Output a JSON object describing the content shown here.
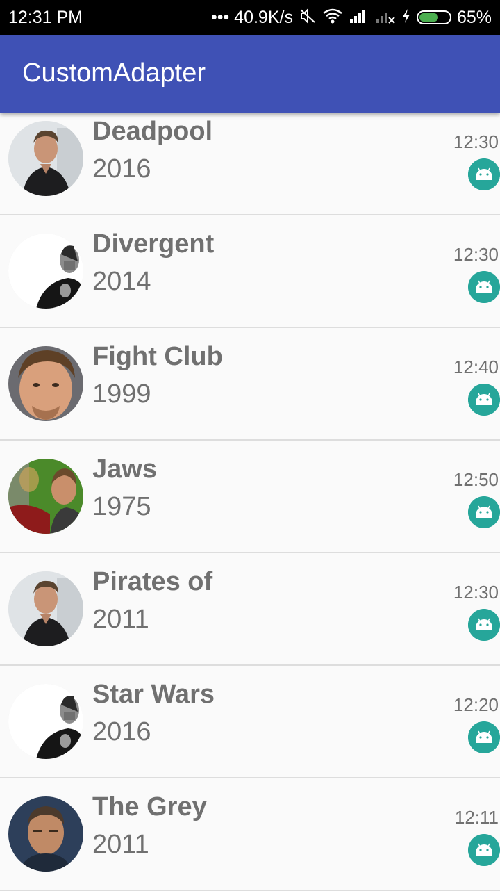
{
  "status_bar": {
    "time": "12:31 PM",
    "network_speed": "••• 40.9K/s",
    "battery_percent": "65%",
    "battery_level": 0.65
  },
  "app_bar": {
    "title": "CustomAdapter"
  },
  "colors": {
    "app_bar": "#3f51b5",
    "badge": "#26a69a",
    "battery": "#4caf50"
  },
  "items": [
    {
      "title": "Deadpool",
      "year": "2016",
      "time": "12:30",
      "avatar": "person-1-photo",
      "badge_icon": "android-icon"
    },
    {
      "title": "Divergent",
      "year": "2014",
      "time": "12:30",
      "avatar": "person-2-photo",
      "badge_icon": "android-icon"
    },
    {
      "title": "Fight Club",
      "year": "1999",
      "time": "12:40",
      "avatar": "person-1-closeup-photo",
      "badge_icon": "android-icon"
    },
    {
      "title": "Jaws",
      "year": "1975",
      "time": "12:50",
      "avatar": "person-1-costume-photo",
      "badge_icon": "android-icon"
    },
    {
      "title": "Pirates of",
      "year": "2011",
      "time": "12:30",
      "avatar": "person-1-photo",
      "badge_icon": "android-icon"
    },
    {
      "title": "Star Wars",
      "year": "2016",
      "time": "12:20",
      "avatar": "person-2-photo",
      "badge_icon": "android-icon"
    },
    {
      "title": "The Grey",
      "year": "2011",
      "time": "12:11",
      "avatar": "person-3-photo",
      "badge_icon": "android-icon"
    }
  ]
}
